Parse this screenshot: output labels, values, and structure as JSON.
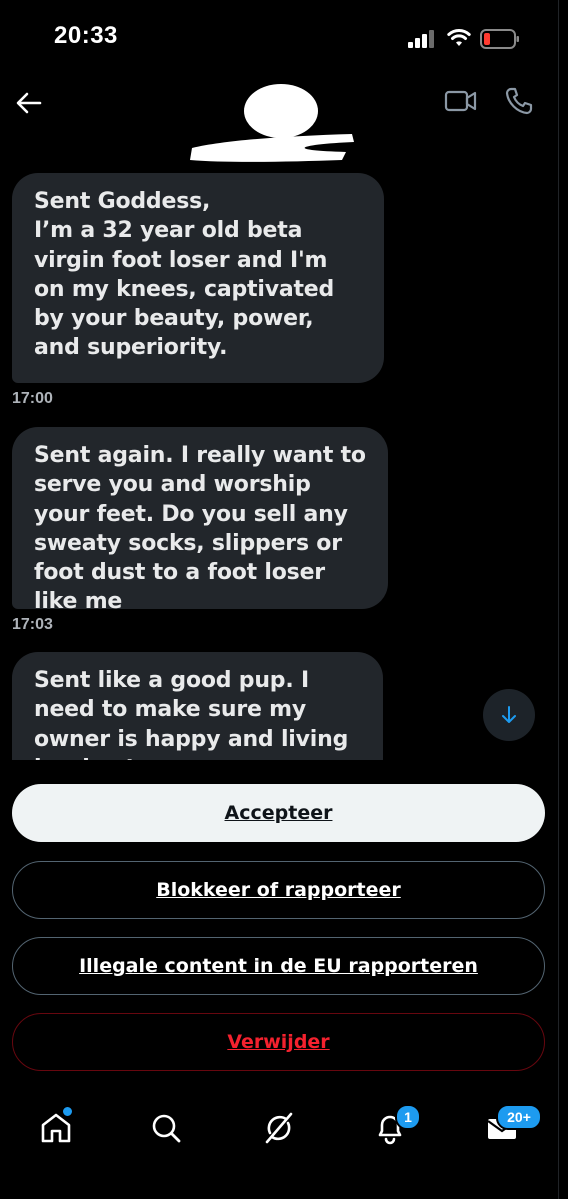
{
  "status_bar": {
    "time": "20:33"
  },
  "chat": {
    "messages": [
      {
        "text": "Sent Goddess,\nI’m a 32 year old beta virgin foot loser and I'm on my knees, captivated by your beauty, power, and superiority.",
        "time": "17:00"
      },
      {
        "text": "Sent again. I really want to serve you and worship your feet. Do you sell any sweaty socks, slippers or foot dust to a foot loser like me",
        "time": "17:03"
      },
      {
        "text": "Sent like a good pup. I need to make sure my owner is happy and living her best",
        "time": ""
      }
    ]
  },
  "actions": {
    "accept_label": "Accepteer",
    "block_label": "Blokkeer of rapporteer",
    "report_label": "Illegale content in de EU rapporteren",
    "delete_label": "Verwijder"
  },
  "tabbar": {
    "notifications_badge": "1",
    "messages_badge": "20+"
  },
  "colors": {
    "accent": "#1d9bf0",
    "danger": "#f4212e",
    "bubble": "#22262b"
  }
}
